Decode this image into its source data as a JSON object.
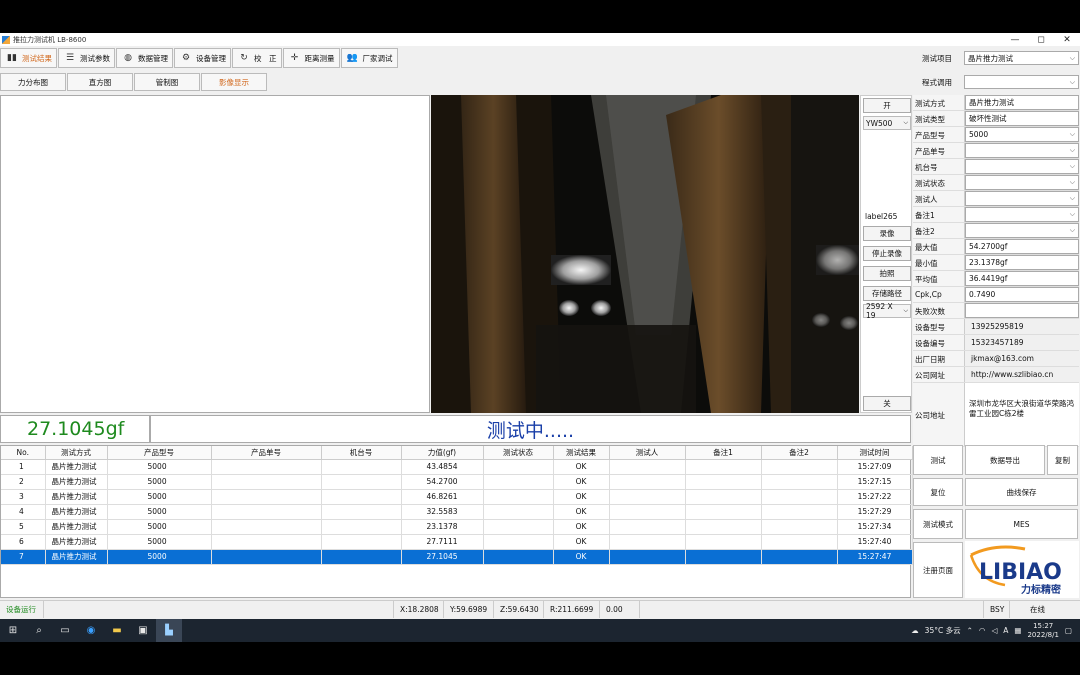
{
  "window": {
    "title": "推拉力测试机 LB-8600",
    "min": "—",
    "max": "◻",
    "close": "✕"
  },
  "toolbar": [
    {
      "label": "测试结果",
      "icon": "bar-chart-icon",
      "glyph": "▮▮",
      "active": true
    },
    {
      "label": "测试参数",
      "icon": "sliders-icon",
      "glyph": "☰",
      "active": false
    },
    {
      "label": "数据管理",
      "icon": "database-icon",
      "glyph": "◍",
      "active": false
    },
    {
      "label": "设备管理",
      "icon": "gears-icon",
      "glyph": "⚙",
      "active": false
    },
    {
      "label": "校　正",
      "icon": "refresh-icon",
      "glyph": "↻",
      "active": false
    },
    {
      "label": "距离测量",
      "icon": "crosshair-icon",
      "glyph": "✛",
      "active": false
    },
    {
      "label": "厂家调试",
      "icon": "users-icon",
      "glyph": "👥",
      "active": false
    }
  ],
  "subtabs": [
    {
      "label": "力分布图",
      "active": false
    },
    {
      "label": "直方图",
      "active": false
    },
    {
      "label": "管制图",
      "active": false
    },
    {
      "label": "影像显示",
      "active": true
    }
  ],
  "top_right": {
    "test_item_label": "测试项目",
    "test_item_value": "晶片推力测试",
    "program_label": "程式调用",
    "program_value": ""
  },
  "camera_controls": {
    "open": "开",
    "model": "YW500",
    "label": "label265",
    "record": "录像",
    "stop_record": "停止录像",
    "snapshot": "拍照",
    "save_path": "存储路径",
    "resolution": "2592 X 19",
    "close": "关"
  },
  "info": [
    {
      "label": "测试方式",
      "value": "晶片推力测试",
      "dropdown": false
    },
    {
      "label": "测试类型",
      "value": "破坏性测试",
      "dropdown": false
    },
    {
      "label": "产品型号",
      "value": "5000",
      "dropdown": true
    },
    {
      "label": "产品单号",
      "value": "",
      "dropdown": true
    },
    {
      "label": "机台号",
      "value": "",
      "dropdown": true
    },
    {
      "label": "测试状态",
      "value": "",
      "dropdown": true
    },
    {
      "label": "测试人",
      "value": "",
      "dropdown": true
    },
    {
      "label": "备注1",
      "value": "",
      "dropdown": true
    },
    {
      "label": "备注2",
      "value": "",
      "dropdown": true
    },
    {
      "label": "最大值",
      "value": "54.2700gf",
      "dropdown": false
    },
    {
      "label": "最小值",
      "value": "23.1378gf",
      "dropdown": false
    },
    {
      "label": "平均值",
      "value": "36.4419gf",
      "dropdown": false
    },
    {
      "label": "Cpk,Cp",
      "value": "0.7490",
      "dropdown": false
    },
    {
      "label": "失败次数",
      "value": "",
      "dropdown": false
    }
  ],
  "contact": [
    {
      "label": "设备型号",
      "value": "13925295819"
    },
    {
      "label": "设备编号",
      "value": "15323457189"
    },
    {
      "label": "出厂日期",
      "value": "jkmax@163.com"
    },
    {
      "label": "公司网址",
      "value": "http://www.szlibiao.cn"
    }
  ],
  "address": {
    "label": "公司地址",
    "value": "深圳市龙华区大浪街道华荣路鸿雷工业园C栋2楼"
  },
  "readout": {
    "value": "27.1045gf",
    "status": "测试中....."
  },
  "table": {
    "columns": [
      "No.",
      "测试方式",
      "产品型号",
      "产品单号",
      "机台号",
      "力值(gf)",
      "测试状态",
      "测试结果",
      "测试人",
      "备注1",
      "备注2",
      "测试时间"
    ],
    "rows": [
      [
        "1",
        "晶片推力测试",
        "5000",
        "",
        "",
        "43.4854",
        "",
        "OK",
        "",
        "",
        "",
        "15:27:09"
      ],
      [
        "2",
        "晶片推力测试",
        "5000",
        "",
        "",
        "54.2700",
        "",
        "OK",
        "",
        "",
        "",
        "15:27:15"
      ],
      [
        "3",
        "晶片推力测试",
        "5000",
        "",
        "",
        "46.8261",
        "",
        "OK",
        "",
        "",
        "",
        "15:27:22"
      ],
      [
        "4",
        "晶片推力测试",
        "5000",
        "",
        "",
        "32.5583",
        "",
        "OK",
        "",
        "",
        "",
        "15:27:29"
      ],
      [
        "5",
        "晶片推力测试",
        "5000",
        "",
        "",
        "23.1378",
        "",
        "OK",
        "",
        "",
        "",
        "15:27:34"
      ],
      [
        "6",
        "晶片推力测试",
        "5000",
        "",
        "",
        "27.7111",
        "",
        "OK",
        "",
        "",
        "",
        "15:27:40"
      ],
      [
        "7",
        "晶片推力测试",
        "5000",
        "",
        "",
        "27.1045",
        "",
        "OK",
        "",
        "",
        "",
        "15:27:47"
      ]
    ],
    "selected_row": 6
  },
  "actions": {
    "test": "测试",
    "export": "数据导出",
    "copy": "复制",
    "reset": "复位",
    "save_curve": "曲线保存",
    "test_mode": "测试模式",
    "mes": "MES",
    "register": "注册页面"
  },
  "logo": {
    "text": "LIBIAO",
    "subtitle": "力标精密",
    "primary_color": "#1a3a8a",
    "accent_color": "#f29a1f"
  },
  "statusbar": {
    "device": "设备运行",
    "x": "X:18.2808",
    "y": "Y:59.6989",
    "z": "Z:59.6430",
    "r": "R:211.6699",
    "v": "0.00",
    "bsy": "BSY",
    "online": "在线"
  },
  "taskbar": {
    "weather": "35°C 多云",
    "ime": "A",
    "time": "15:27",
    "date": "2022/8/1"
  }
}
